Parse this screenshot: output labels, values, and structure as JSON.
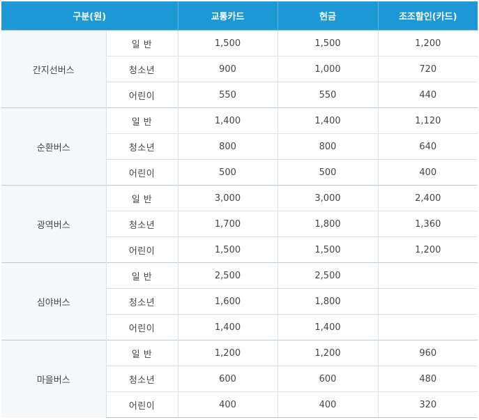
{
  "header": {
    "col_category": "구분(원)",
    "col_card": "교통카드",
    "col_cash": "현금",
    "col_early": "조조할인(카드)"
  },
  "groups": [
    {
      "name": "간지선버스",
      "rows": [
        {
          "type": "일 반",
          "card": "1,500",
          "cash": "1,500",
          "early": "1,200"
        },
        {
          "type": "청소년",
          "card": "900",
          "cash": "1,000",
          "early": "720"
        },
        {
          "type": "어린이",
          "card": "550",
          "cash": "550",
          "early": "440"
        }
      ]
    },
    {
      "name": "순환버스",
      "rows": [
        {
          "type": "일 반",
          "card": "1,400",
          "cash": "1,400",
          "early": "1,120"
        },
        {
          "type": "청소년",
          "card": "800",
          "cash": "800",
          "early": "640"
        },
        {
          "type": "어린이",
          "card": "500",
          "cash": "500",
          "early": "400"
        }
      ]
    },
    {
      "name": "광역버스",
      "rows": [
        {
          "type": "일 반",
          "card": "3,000",
          "cash": "3,000",
          "early": "2,400"
        },
        {
          "type": "청소년",
          "card": "1,700",
          "cash": "1,800",
          "early": "1,360"
        },
        {
          "type": "어린이",
          "card": "1,500",
          "cash": "1,500",
          "early": "1,200"
        }
      ]
    },
    {
      "name": "심야버스",
      "rows": [
        {
          "type": "일 반",
          "card": "2,500",
          "cash": "2,500",
          "early": ""
        },
        {
          "type": "청소년",
          "card": "1,600",
          "cash": "1,800",
          "early": ""
        },
        {
          "type": "어린이",
          "card": "1,400",
          "cash": "1,400",
          "early": ""
        }
      ]
    },
    {
      "name": "마을버스",
      "rows": [
        {
          "type": "일 반",
          "card": "1,200",
          "cash": "1,200",
          "early": "960"
        },
        {
          "type": "청소년",
          "card": "600",
          "cash": "600",
          "early": "480"
        },
        {
          "type": "어린이",
          "card": "400",
          "cash": "400",
          "early": "320"
        }
      ]
    }
  ]
}
